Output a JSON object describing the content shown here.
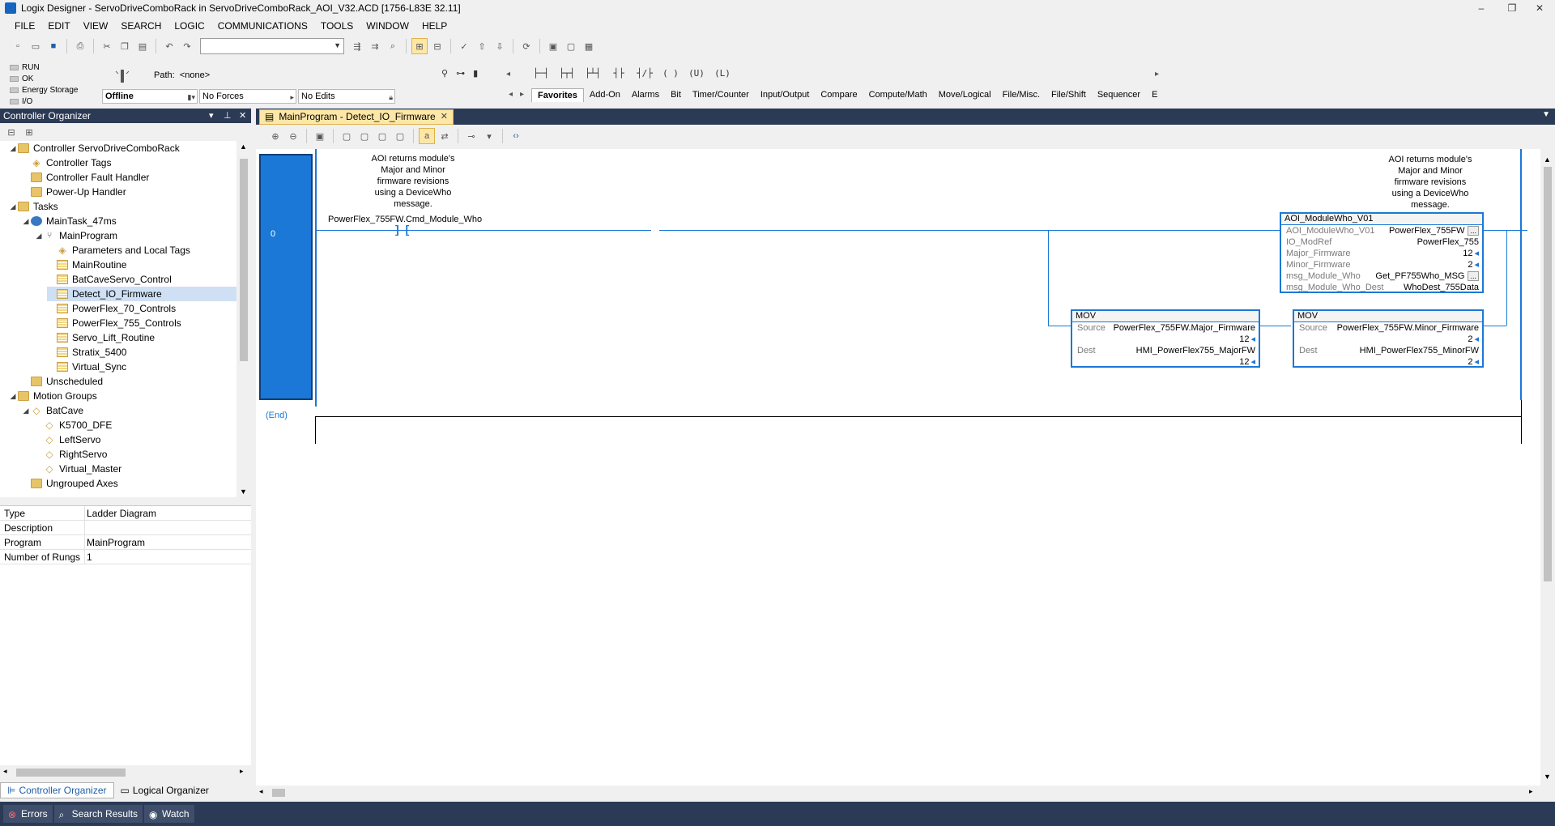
{
  "window": {
    "title": "Logix Designer - ServoDriveComboRack in ServoDriveComboRack_AOI_V32.ACD [1756-L83E 32.11]",
    "minimize": "–",
    "restore": "❐",
    "close": "✕"
  },
  "menu": [
    "FILE",
    "EDIT",
    "VIEW",
    "SEARCH",
    "LOGIC",
    "COMMUNICATIONS",
    "TOOLS",
    "WINDOW",
    "HELP"
  ],
  "status": {
    "leds": [
      "RUN",
      "OK",
      "Energy Storage",
      "I/O"
    ],
    "path_label": "Path:",
    "path_value": "<none>",
    "mode": "Offline",
    "forces": "No Forces",
    "edits": "No Edits"
  },
  "instructions": {
    "icons": [
      "├─┤",
      "├┬┤",
      "├┴┤",
      "┤├",
      "┤/├",
      "( )",
      "(U)",
      "(L)"
    ],
    "tabs": [
      "Favorites",
      "Add-On",
      "Alarms",
      "Bit",
      "Timer/Counter",
      "Input/Output",
      "Compare",
      "Compute/Math",
      "Move/Logical",
      "File/Misc.",
      "File/Shift",
      "Sequencer",
      "E"
    ],
    "active_tab": 0
  },
  "organizer": {
    "title": "Controller Organizer",
    "tree": [
      {
        "label": "Controller ServoDriveComboRack",
        "level": 0,
        "icon": "folder",
        "exp": "◢"
      },
      {
        "label": "Controller Tags",
        "level": 1,
        "icon": "tag",
        "exp": ""
      },
      {
        "label": "Controller Fault Handler",
        "level": 1,
        "icon": "folder",
        "exp": ""
      },
      {
        "label": "Power-Up Handler",
        "level": 1,
        "icon": "folder",
        "exp": ""
      },
      {
        "label": "Tasks",
        "level": 0,
        "icon": "folder",
        "exp": "◢"
      },
      {
        "label": "MainTask_47ms",
        "level": 1,
        "icon": "task",
        "exp": "◢"
      },
      {
        "label": "MainProgram",
        "level": 2,
        "icon": "program",
        "exp": "◢"
      },
      {
        "label": "Parameters and Local Tags",
        "level": 3,
        "icon": "tag",
        "exp": ""
      },
      {
        "label": "MainRoutine",
        "level": 3,
        "icon": "routine",
        "exp": ""
      },
      {
        "label": "BatCaveServo_Control",
        "level": 3,
        "icon": "routine",
        "exp": ""
      },
      {
        "label": "Detect_IO_Firmware",
        "level": 3,
        "icon": "routine",
        "exp": "",
        "selected": true
      },
      {
        "label": "PowerFlex_70_Controls",
        "level": 3,
        "icon": "routine",
        "exp": ""
      },
      {
        "label": "PowerFlex_755_Controls",
        "level": 3,
        "icon": "routine",
        "exp": ""
      },
      {
        "label": "Servo_Lift_Routine",
        "level": 3,
        "icon": "routine",
        "exp": ""
      },
      {
        "label": "Stratix_5400",
        "level": 3,
        "icon": "routine",
        "exp": ""
      },
      {
        "label": "Virtual_Sync",
        "level": 3,
        "icon": "routine",
        "exp": ""
      },
      {
        "label": "Unscheduled",
        "level": 1,
        "icon": "folder",
        "exp": ""
      },
      {
        "label": "Motion Groups",
        "level": 0,
        "icon": "folder",
        "exp": "◢"
      },
      {
        "label": "BatCave",
        "level": 1,
        "icon": "axis",
        "exp": "◢"
      },
      {
        "label": "K5700_DFE",
        "level": 2,
        "icon": "axis",
        "exp": ""
      },
      {
        "label": "LeftServo",
        "level": 2,
        "icon": "axis",
        "exp": ""
      },
      {
        "label": "RightServo",
        "level": 2,
        "icon": "axis",
        "exp": ""
      },
      {
        "label": "Virtual_Master",
        "level": 2,
        "icon": "axis",
        "exp": ""
      },
      {
        "label": "Ungrouped Axes",
        "level": 1,
        "icon": "folder",
        "exp": ""
      }
    ],
    "properties": [
      {
        "k": "Type",
        "v": "Ladder Diagram"
      },
      {
        "k": "Description",
        "v": ""
      },
      {
        "k": "Program",
        "v": "MainProgram"
      },
      {
        "k": "Number of Rungs",
        "v": "1"
      }
    ],
    "tabs": [
      "Controller Organizer",
      "Logical Organizer"
    ]
  },
  "bottom_tabs": [
    "Errors",
    "Search Results",
    "Watch"
  ],
  "editor": {
    "tab_label": "MainProgram - Detect_IO_Firmware",
    "rung_number": "0",
    "end_label": "(End)",
    "comment_left": [
      "AOI returns module's",
      "Major and Minor",
      "firmware revisions",
      "using a DeviceWho",
      "message."
    ],
    "comment_right": [
      "AOI returns module's",
      "Major and Minor",
      "firmware revisions",
      "using a DeviceWho",
      "message."
    ],
    "contact_tag": "PowerFlex_755FW.Cmd_Module_Who",
    "aoi": {
      "name": "AOI_ModuleWho_V01",
      "rows": [
        {
          "p": "AOI_ModuleWho_V01",
          "v": "PowerFlex_755FW",
          "dots": true
        },
        {
          "p": "IO_ModRef",
          "v": "PowerFlex_755"
        },
        {
          "p": "Major_Firmware",
          "v": "12",
          "arrow": true
        },
        {
          "p": "Minor_Firmware",
          "v": "2",
          "arrow": true
        },
        {
          "p": "msg_Module_Who",
          "v": "Get_PF755Who_MSG",
          "dots": true
        },
        {
          "p": "msg_Module_Who_Dest",
          "v": "WhoDest_755Data"
        }
      ]
    },
    "mov1": {
      "name": "MOV",
      "source_label": "Source",
      "source": "PowerFlex_755FW.Major_Firmware",
      "source_val": "12",
      "dest_label": "Dest",
      "dest": "HMI_PowerFlex755_MajorFW",
      "dest_val": "12"
    },
    "mov2": {
      "name": "MOV",
      "source_label": "Source",
      "source": "PowerFlex_755FW.Minor_Firmware",
      "source_val": "2",
      "dest_label": "Dest",
      "dest": "HMI_PowerFlex755_MinorFW",
      "dest_val": "2"
    }
  },
  "colors": {
    "accent": "#1b78d6",
    "header": "#2b3a55",
    "selected_tab": "#fde7a6"
  }
}
